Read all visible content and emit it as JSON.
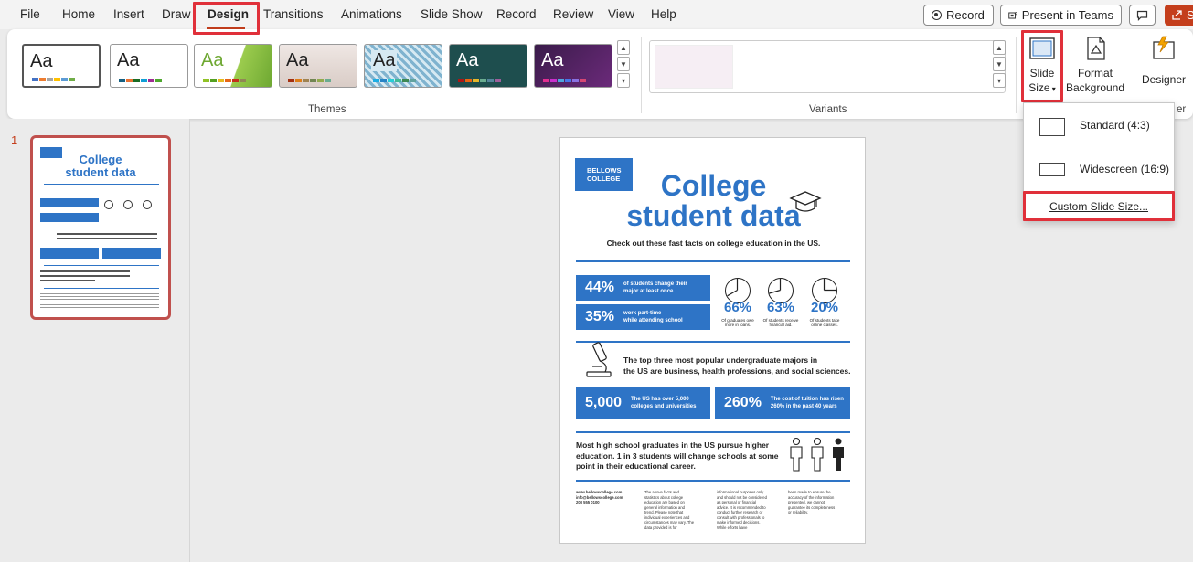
{
  "menu": {
    "tabs": [
      "File",
      "Home",
      "Insert",
      "Draw",
      "Design",
      "Transitions",
      "Animations",
      "Slide Show",
      "Record",
      "Review",
      "View",
      "Help"
    ],
    "active_tab": "Design",
    "record_label": "Record",
    "present_teams_label": "Present in Teams",
    "share_label": "S"
  },
  "ribbon": {
    "themes_label": "Themes",
    "variants_label": "Variants",
    "theme_text": "Aa",
    "slide_size_label_1": "Slide",
    "slide_size_label_2": "Size",
    "format_bg_label_1": "Format",
    "format_bg_label_2": "Background",
    "designer_label": "Designer",
    "designer_group_label": "er"
  },
  "dropdown": {
    "standard_label": "Standard (4:3)",
    "widescreen_label": "Widescreen (16:9)",
    "custom_label": "Custom Slide Size..."
  },
  "slide_panel": {
    "slide_number": "1"
  },
  "slide": {
    "logo_line1": "BELLOWS",
    "logo_line2": "COLLEGE",
    "title_line1": "College",
    "title_line2": "student data",
    "subtitle": "Check out these fast facts on college education in the US.",
    "stat1_num": "44%",
    "stat1_text_1": "of students change their",
    "stat1_text_2": "major at least once",
    "stat2_num": "35%",
    "stat2_text_1": "work part-time",
    "stat2_text_2": "while attending school",
    "pie1_pct": "66%",
    "pie1_cap": "Of graduates owe more in loans.",
    "pie2_pct": "63%",
    "pie2_cap": "Of students receive financial aid.",
    "pie3_pct": "20%",
    "pie3_cap": "Of students take online classes.",
    "majors_line1": "The top three most popular undergraduate majors in",
    "majors_line2": "the US are business, health professions, and social sciences.",
    "stat3_num": "5,000",
    "stat3_text_1": "The US has over 5,000",
    "stat3_text_2": "colleges and universities",
    "stat4_num": "260%",
    "stat4_text_1": "The cost of tuition has risen",
    "stat4_text_2": "260% in the past 40 years",
    "hs_line1": "Most high school graduates in the US pursue higher",
    "hs_line2": "education. 1 in 3 students will change schools at some",
    "hs_line3": "point in their educational career.",
    "footer_web": "www.bellowscollege.com",
    "footer_email": "info@bellowscollege.com",
    "footer_phone": "208 555 0100",
    "footer_col2": "The above facts and statistics about college education are based on general information and trend. Please note that individual experiences and circumstances may vary. The data provided is for",
    "footer_col3": "informational purposes only and should not be considered as personal or financial advice. It is recommended to conduct further research or consult with professionals to make informed decisions. While efforts have",
    "footer_col4": "been made to ensure the accuracy of the information presented, we cannot guarantee its completeness or reliability."
  },
  "colors": {
    "accent": "#c43e1c",
    "slide_blue": "#2e74c6",
    "highlight_red": "#e0303a"
  }
}
